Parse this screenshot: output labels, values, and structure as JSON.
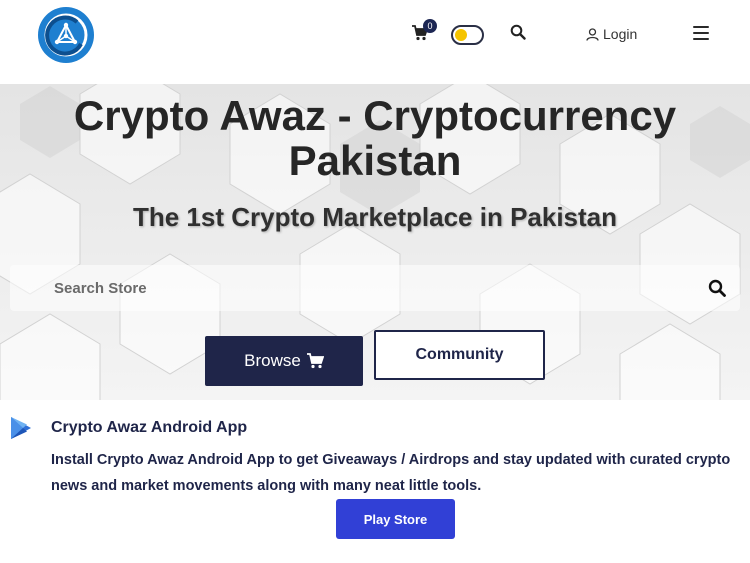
{
  "header": {
    "logo_icon": "crypto-awaz-logo",
    "cart_icon": "shopping-cart-icon",
    "cart_count": "0",
    "theme_toggle_icon": "toggle-switch",
    "search_icon": "search-icon",
    "login_label": "Login",
    "user_icon": "user-icon",
    "menu_icon": "hamburger-menu-icon"
  },
  "hero": {
    "title": "Crypto Awaz - Cryptocurrency Pakistan",
    "subtitle": "The 1st Crypto Marketplace in Pakistan",
    "search": {
      "placeholder": "Search Store",
      "value": ""
    },
    "browse_label": "Browse",
    "community_label": "Community"
  },
  "promo": {
    "icon": "play-store-icon",
    "title": "Crypto Awaz Android App",
    "text": "Install Crypto Awaz Android App to get Giveaways / Airdrops and stay updated with curated crypto news and market movements along with many neat little tools.",
    "button_label": "Play Store"
  },
  "colors": {
    "navy": "#1f2549",
    "toggle_knob": "#f5c400",
    "play_button": "#3140d6",
    "logo_blue": "#1e7fd0"
  }
}
